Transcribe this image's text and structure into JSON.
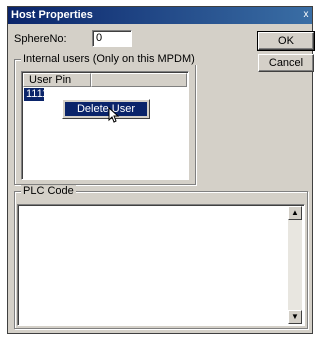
{
  "window": {
    "title": "Host Properties",
    "close_glyph": "x"
  },
  "sphere": {
    "label": "SphereNo:",
    "value": "0"
  },
  "buttons": {
    "ok": "OK",
    "cancel": "Cancel"
  },
  "users_group": {
    "title": "Internal users (Only on this MPDM)",
    "columns": [
      "User Pin",
      ""
    ],
    "rows": [
      {
        "pin": "1111"
      }
    ]
  },
  "context_menu": {
    "items": [
      "Delete User"
    ]
  },
  "plc_group": {
    "title": "PLC Code",
    "value": ""
  },
  "scrollbar": {
    "up_glyph": "▲",
    "down_glyph": "▼"
  }
}
